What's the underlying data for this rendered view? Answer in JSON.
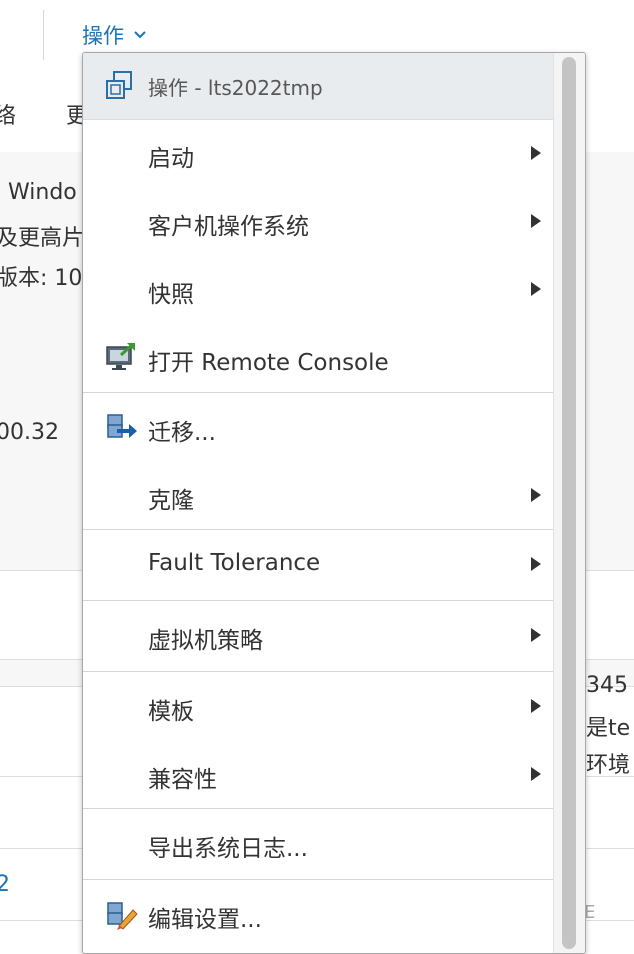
{
  "colors": {
    "accent": "#1b74b8",
    "menu_header_bg": "#e9ecee",
    "text": "#333333"
  },
  "topbar": {
    "actions_label": "操作"
  },
  "background": {
    "tab_left": "络",
    "tab_right": "更",
    "text_windows": "Windo",
    "text_higher": "及更高片",
    "text_version": "版本: 10",
    "text_ip": "00.32",
    "text_345": "345",
    "text_is_te": "是te",
    "text_env": "环境",
    "text_link2": "2",
    "text_edge": "E"
  },
  "menu": {
    "header": {
      "title": "操作 - lts2022tmp",
      "icon": "vm-actions-icon"
    },
    "items": [
      {
        "label": "启动",
        "submenu": true
      },
      {
        "label": "客户机操作系统",
        "submenu": true
      },
      {
        "label": "快照",
        "submenu": true
      },
      {
        "label": "打开 Remote Console",
        "submenu": false,
        "icon": "remote-console-icon"
      },
      {
        "label": "迁移...",
        "submenu": false,
        "icon": "migrate-icon"
      },
      {
        "label": "克隆",
        "submenu": true
      },
      {
        "label": "Fault Tolerance",
        "submenu": true
      },
      {
        "label": "虚拟机策略",
        "submenu": true
      },
      {
        "label": "模板",
        "submenu": true
      },
      {
        "label": "兼容性",
        "submenu": true
      },
      {
        "label": "导出系统日志...",
        "submenu": false
      },
      {
        "label": "编辑设置...",
        "submenu": false,
        "icon": "edit-settings-icon"
      }
    ]
  }
}
